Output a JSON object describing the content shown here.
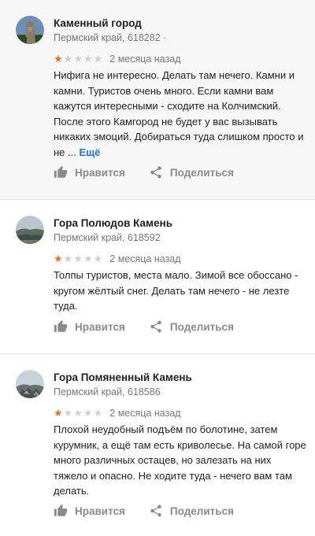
{
  "reviews": [
    {
      "place_name": "Каменный город",
      "address": "Пермский край, 618282 ·",
      "rating": 1,
      "rating_max": 5,
      "date": "2 месяца назад",
      "text": "Нифига не интересно. Делать там нечего. Камни и камни. Туристов очень много. Если камни вам кажутся интересными - сходите на Колчимский. После этого Камгород не будет у вас вызывать никаких эмоций. Добираться туда слишком просто и не ...",
      "more_label": "Ещё",
      "like_label": "Нравится",
      "share_label": "Поделиться",
      "avatar_icon": "rock-tower-photo"
    },
    {
      "place_name": "Гора Полюдов Камень",
      "address": "Пермский край, 618592",
      "rating": 1,
      "rating_max": 5,
      "date": "2 месяца назад",
      "text": "Толпы туристов, места мало. Зимой все обоссано - кругом жёлтый снег. Делать там нечего - не лезте туда.",
      "like_label": "Нравится",
      "share_label": "Поделиться",
      "avatar_icon": "mountain-landscape-photo"
    },
    {
      "place_name": "Гора Помяненный Камень",
      "address": "Пермский край, 618586",
      "rating": 1,
      "rating_max": 5,
      "date": "2 месяца назад",
      "text": "Плохой неудобный подъём по болотине, затем курумник, а ещё там есть криволесье. На самой горе много различных остацев, но залезать на них тяжело и опасно. Не ходите туда - нечего вам там делать.",
      "like_label": "Нравится",
      "share_label": "Поделиться",
      "avatar_icon": "rocky-summit-photo"
    }
  ],
  "colors": {
    "star_on": "#e7711b",
    "star_off": "#d0d0d0",
    "link": "#1a73e8",
    "muted": "#8a8a8a"
  }
}
